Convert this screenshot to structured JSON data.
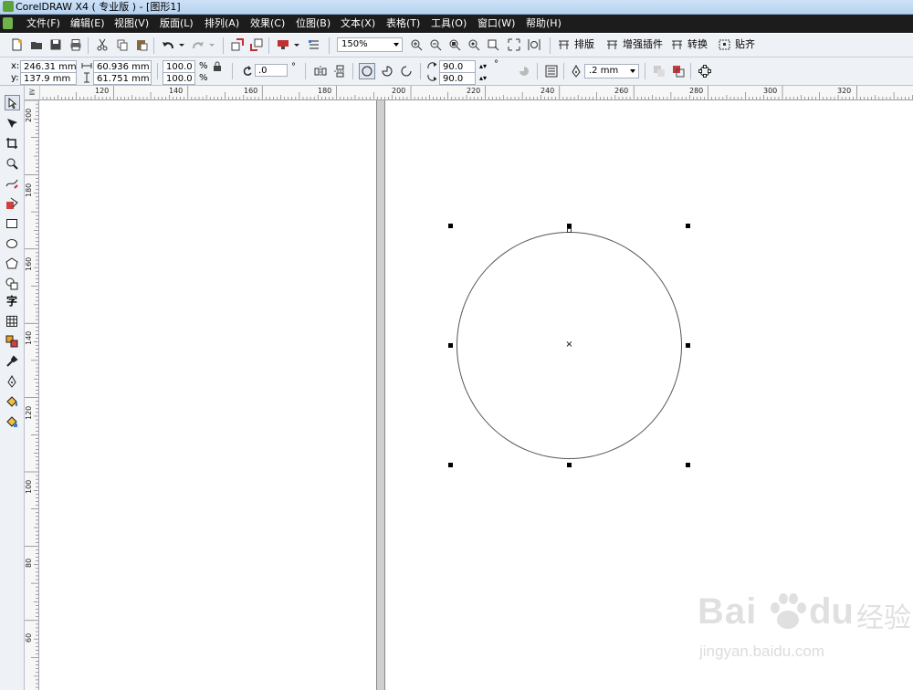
{
  "window": {
    "title": "CorelDRAW X4 ( 专业版 ) - [图形1]"
  },
  "menu": {
    "items": [
      "文件(F)",
      "编辑(E)",
      "视图(V)",
      "版面(L)",
      "排列(A)",
      "效果(C)",
      "位图(B)",
      "文本(X)",
      "表格(T)",
      "工具(O)",
      "窗口(W)",
      "帮助(H)"
    ]
  },
  "standard_toolbar": {
    "zoom_level": "150%",
    "plugins": [
      "排版",
      "增强插件",
      "转换",
      "贴齐"
    ]
  },
  "property_bar": {
    "x_label": "x:",
    "x_value": "246.31 mm",
    "y_label": "y:",
    "y_value": "137.9 mm",
    "width_value": "60.936 mm",
    "height_value": "61.751 mm",
    "scale_x": "100.0",
    "scale_y": "100.0",
    "percent_symbol": "%",
    "rotation_value": ".0",
    "degree_symbol": "°",
    "start_angle": "90.0",
    "end_angle": "90.0",
    "outline_width": ".2 mm"
  },
  "rulers": {
    "corner_symbol": "≧",
    "horizontal_labels": [
      "120",
      "140",
      "160",
      "180",
      "200",
      "220",
      "240",
      "260",
      "280",
      "300",
      "320"
    ],
    "vertical_labels": [
      "200",
      "180",
      "160",
      "140",
      "120",
      "100",
      "80",
      "60"
    ]
  },
  "canvas": {
    "center_marker": "×"
  },
  "watermark": {
    "brand": "Bai",
    "brand_suffix": "du",
    "cn_text": "经验",
    "url": "jingyan.baidu.com"
  },
  "colors": {
    "menubar_bg": "#1c1c1c",
    "toolbar_bg": "#eef1f5",
    "page_bg": "#ffffff",
    "handle": "#000000"
  }
}
